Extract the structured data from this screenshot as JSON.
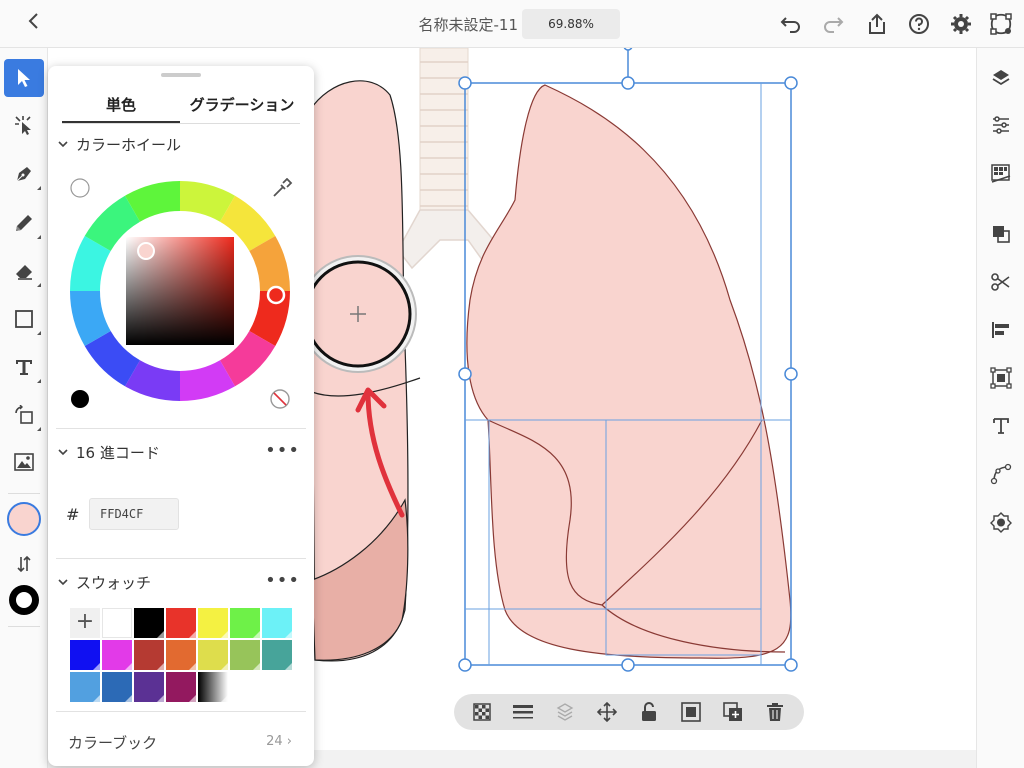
{
  "topbar": {
    "back_icon": "chevron-left-icon",
    "title": "名称未設定-11",
    "zoom": "69.88%",
    "icons": [
      "undo-icon",
      "redo-icon",
      "share-icon",
      "help-icon",
      "gear-icon",
      "view-mode-icon"
    ]
  },
  "tools": [
    "selection-tool",
    "direct-selection-tool",
    "pen-tool",
    "pencil-tool",
    "eraser-tool",
    "rectangle-tool",
    "type-tool",
    "rotate-tool",
    "place-image-tool"
  ],
  "fill_color": "#F9D4CF",
  "stroke_color": "#000000",
  "color_panel": {
    "tabs": [
      "単色",
      "グラデーション"
    ],
    "active_tab": "単色",
    "wheel_section": "カラーホイール",
    "hex_section": "16 進コード",
    "hex_prefix": "#",
    "hex_value": "FFD4CF",
    "swatches_section": "スウォッチ",
    "add_swatch": "+",
    "swatches": [
      "#ffffff",
      "#000000",
      "#e8332a",
      "#f4f142",
      "#6ef148",
      "#6cf1f7",
      "#1010f2",
      "#e23ae8",
      "#b53a32",
      "#e26a30",
      "#dedd4c",
      "#97c45a",
      "#47a49a",
      "#52a0e0",
      "#2c6ab6",
      "#5b3194",
      "#93195f",
      "gradient"
    ],
    "color_book": "カラーブック",
    "color_book_count": "24"
  },
  "right_tools": [
    "layers-icon",
    "properties-icon",
    "libraries-icon",
    "pathfinder-icon",
    "scissors-icon",
    "align-icon",
    "transform-icon",
    "type-panel-icon",
    "path-icon",
    "repeat-grid-icon"
  ],
  "context_bar": [
    "transparency-icon",
    "stroke-lines-icon",
    "arrange-icon",
    "move-icon",
    "lock-icon",
    "group-icon",
    "duplicate-icon",
    "delete-icon"
  ]
}
